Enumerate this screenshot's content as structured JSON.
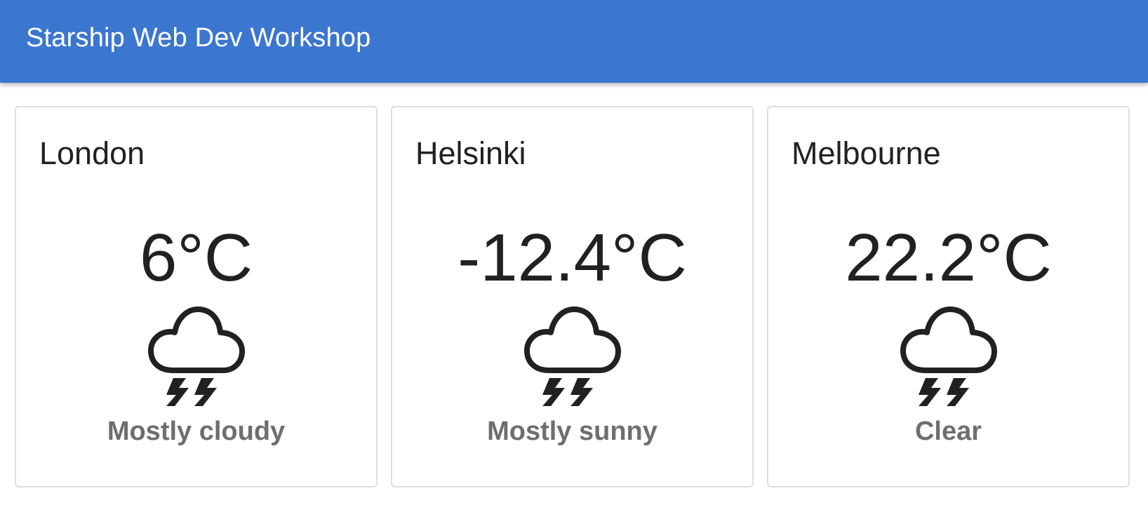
{
  "header": {
    "title": "Starship Web Dev Workshop",
    "background_color": "#3b76cf"
  },
  "cards": [
    {
      "city": "London",
      "temperature": "6°C",
      "description": "Mostly cloudy",
      "icon": "cloud-thunderstorm-icon"
    },
    {
      "city": "Helsinki",
      "temperature": "-12.4°C",
      "description": "Mostly sunny",
      "icon": "cloud-thunderstorm-icon"
    },
    {
      "city": "Melbourne",
      "temperature": "22.2°C",
      "description": "Clear",
      "icon": "cloud-thunderstorm-icon"
    }
  ]
}
